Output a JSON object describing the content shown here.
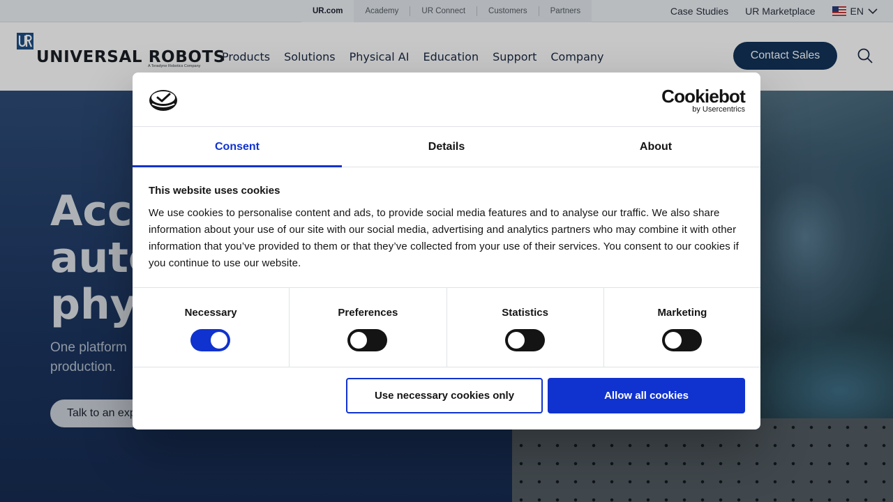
{
  "utility_bar": {
    "sites": [
      "UR.com",
      "Academy",
      "UR Connect",
      "Customers",
      "Partners"
    ],
    "active_site": "UR.com",
    "links": [
      "Case Studies",
      "UR Marketplace"
    ],
    "language": "EN",
    "flag_icon": "us-flag-icon"
  },
  "header": {
    "logo_mark": "UR",
    "logo_text": "UNIVERSAL ROBOTS",
    "logo_tagline": "A Teradyne Robotics Company",
    "nav": [
      "Products",
      "Solutions",
      "Physical AI",
      "Education",
      "Support",
      "Company"
    ],
    "contact_label": "Contact Sales",
    "search_icon": "search-icon",
    "accent": "#12345a"
  },
  "hero": {
    "title": "Acce\nauto\nphys",
    "subtitle": "One platform\nproduction.",
    "cta_label": "Talk to an exp"
  },
  "consent": {
    "brand": "Cookiebot",
    "brand_sub": "by Usercentrics",
    "tabs": [
      "Consent",
      "Details",
      "About"
    ],
    "active_tab": "Consent",
    "heading": "This website uses cookies",
    "body": "We use cookies to personalise content and ads, to provide social media features and to analyse our traffic. We also share information about your use of our site with our social media, advertising and analytics partners who may combine it with other information that you’ve provided to them or that they’ve collected from your use of their services. You consent to our cookies if you continue to use our website.",
    "categories": [
      {
        "label": "Necessary",
        "enabled": true
      },
      {
        "label": "Preferences",
        "enabled": false
      },
      {
        "label": "Statistics",
        "enabled": false
      },
      {
        "label": "Marketing",
        "enabled": false
      }
    ],
    "necessary_only_label": "Use necessary cookies only",
    "allow_all_label": "Allow all cookies",
    "accent": "#1032cf"
  }
}
